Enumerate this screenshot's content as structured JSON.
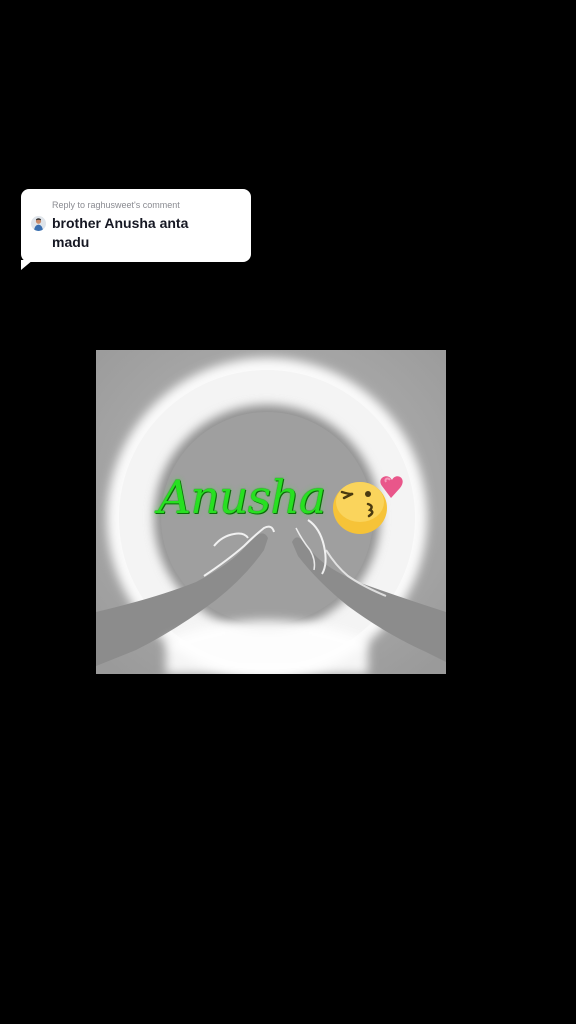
{
  "reply": {
    "label": "Reply to raghusweet's comment",
    "comment": "brother Anusha anta madu"
  },
  "video": {
    "overlay_text": "Anusha",
    "emoji_icon": "kissing-face-heart-icon"
  },
  "colors": {
    "background": "#000000",
    "bubble": "#ffffff",
    "overlay_text": "#27e021",
    "emoji_face": "#f6c338",
    "emoji_heart": "#e9568a"
  }
}
